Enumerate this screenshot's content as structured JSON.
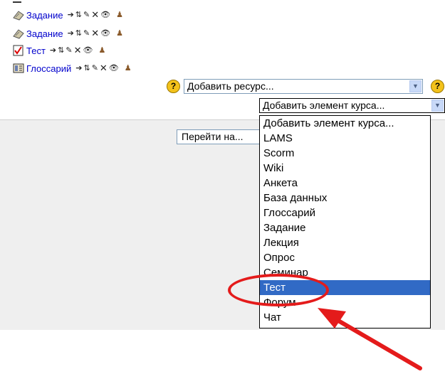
{
  "activities": [
    {
      "name": "Задание",
      "icon": "assignment-icon"
    },
    {
      "name": "Задание",
      "icon": "assignment-icon"
    },
    {
      "name": "Тест",
      "icon": "quiz-icon"
    },
    {
      "name": "Глоссарий",
      "icon": "glossary-icon"
    }
  ],
  "controls": {
    "move": "➔",
    "move_updown": "⇅",
    "edit": "✎",
    "delete": "✕",
    "hide": "👁",
    "roles": "♟"
  },
  "help_symbol": "?",
  "add_resource": {
    "selected": "Добавить ресурс..."
  },
  "add_activity": {
    "selected": "Добавить элемент курса...",
    "options": [
      "Добавить элемент курса...",
      "LAMS",
      "Scorm",
      "Wiki",
      "Анкета",
      "База данных",
      "Глоссарий",
      "Задание",
      "Лекция",
      "Опрос",
      "Семинар",
      "Тест",
      "Форум",
      "Чат"
    ],
    "highlighted_option": "Тест"
  },
  "jump_to": {
    "selected": "Перейти на..."
  },
  "colors": {
    "link": "#0000cc",
    "highlight": "#316ac5",
    "annotation": "#e41b1b",
    "panel_bg": "#efefef"
  }
}
